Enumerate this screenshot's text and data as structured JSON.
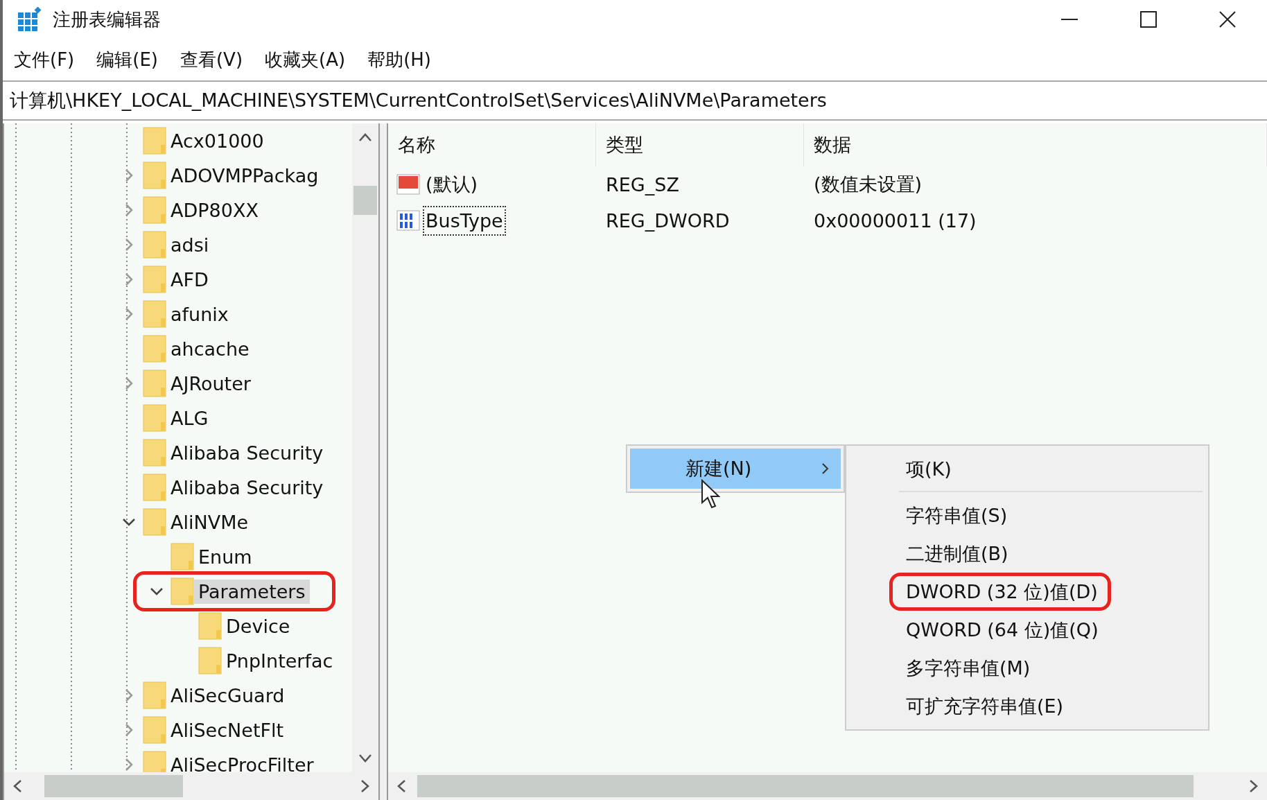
{
  "window": {
    "title": "注册表编辑器"
  },
  "menu": [
    "文件(F)",
    "编辑(E)",
    "查看(V)",
    "收藏夹(A)",
    "帮助(H)"
  ],
  "address": "计算机\\HKEY_LOCAL_MACHINE\\SYSTEM\\CurrentControlSet\\Services\\AliNVMe\\Parameters",
  "tree": [
    {
      "label": "Acx01000",
      "has_children": false,
      "selected": false,
      "annotated": false
    },
    {
      "label": "ADOVMPPackag",
      "has_children": true,
      "expanded": false,
      "selected": false,
      "annotated": false
    },
    {
      "label": "ADP80XX",
      "has_children": true,
      "expanded": false,
      "selected": false,
      "annotated": false
    },
    {
      "label": "adsi",
      "has_children": true,
      "expanded": false,
      "selected": false,
      "annotated": false
    },
    {
      "label": "AFD",
      "has_children": true,
      "expanded": false,
      "selected": false,
      "annotated": false
    },
    {
      "label": "afunix",
      "has_children": true,
      "expanded": false,
      "selected": false,
      "annotated": false
    },
    {
      "label": "ahcache",
      "has_children": false,
      "selected": false,
      "annotated": false
    },
    {
      "label": "AJRouter",
      "has_children": true,
      "expanded": false,
      "selected": false,
      "annotated": false
    },
    {
      "label": "ALG",
      "has_children": false,
      "selected": false,
      "annotated": false
    },
    {
      "label": "Alibaba Security",
      "has_children": false,
      "selected": false,
      "annotated": false
    },
    {
      "label": "Alibaba Security",
      "has_children": false,
      "selected": false,
      "annotated": false
    },
    {
      "label": "AliNVMe",
      "has_children": true,
      "expanded": true,
      "selected": false,
      "annotated": false,
      "children": [
        {
          "label": "Enum",
          "has_children": false,
          "selected": false,
          "annotated": false
        },
        {
          "label": "Parameters",
          "has_children": true,
          "expanded": true,
          "selected": true,
          "annotated": true,
          "children": [
            {
              "label": "Device",
              "has_children": false,
              "selected": false,
              "annotated": false
            },
            {
              "label": "PnpInterfac",
              "has_children": false,
              "selected": false,
              "annotated": false
            }
          ]
        }
      ]
    },
    {
      "label": "AliSecGuard",
      "has_children": true,
      "expanded": false,
      "selected": false,
      "annotated": false
    },
    {
      "label": "AliSecNetFlt",
      "has_children": true,
      "expanded": false,
      "selected": false,
      "annotated": false
    },
    {
      "label": "AliSecProcFilter",
      "has_children": true,
      "expanded": false,
      "selected": false,
      "annotated": false
    }
  ],
  "table": {
    "columns": [
      "名称",
      "类型",
      "数据"
    ],
    "rows": [
      {
        "kind": "string",
        "name": "(默认)",
        "type": "REG_SZ",
        "data": "(数值未设置)",
        "focused": false
      },
      {
        "kind": "binary",
        "name": "BusType",
        "type": "REG_DWORD",
        "data": "0x00000011 (17)",
        "focused": true
      }
    ]
  },
  "context_menu": {
    "items": [
      {
        "label": "新建(N)",
        "selected": true,
        "submenu": true
      }
    ],
    "submenu": [
      {
        "label": "项(K)",
        "separator_after": true,
        "annotated": false
      },
      {
        "label": "字符串值(S)",
        "annotated": false
      },
      {
        "label": "二进制值(B)",
        "annotated": false
      },
      {
        "label": "DWORD (32 位)值(D)",
        "annotated": true
      },
      {
        "label": "QWORD (64 位)值(Q)",
        "annotated": false
      },
      {
        "label": "多字符串值(M)",
        "annotated": false
      },
      {
        "label": "可扩充字符串值(E)",
        "annotated": false
      }
    ]
  }
}
